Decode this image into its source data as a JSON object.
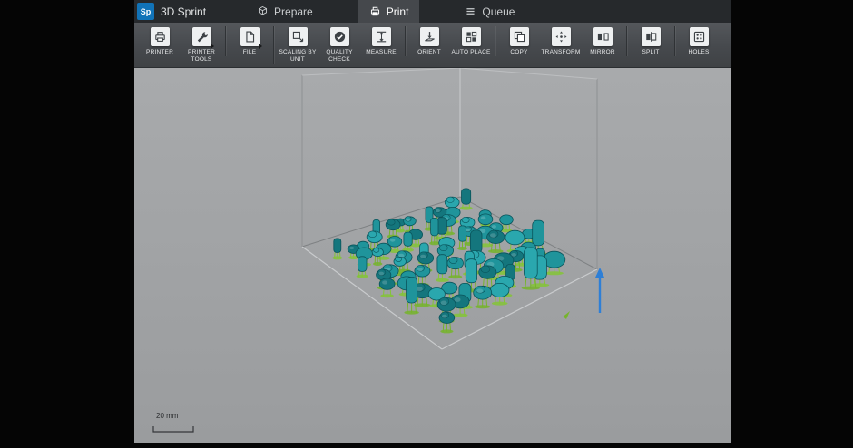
{
  "app": {
    "logo_text": "Sp",
    "title": "3D Sprint"
  },
  "tabs": [
    {
      "label": "Prepare",
      "icon": "cube-icon",
      "active": false
    },
    {
      "label": "Print",
      "icon": "printer-icon",
      "active": true
    },
    {
      "label": "Queue",
      "icon": "menu-icon",
      "active": false
    }
  ],
  "toolbar": {
    "groups": [
      {
        "buttons": [
          {
            "label": "PRINTER",
            "icon": "printer-icon",
            "flyout": false
          },
          {
            "label": "PRINTER TOOLS",
            "icon": "wrench-icon",
            "flyout": true
          }
        ]
      },
      {
        "buttons": [
          {
            "label": "FILE",
            "icon": "file-icon",
            "flyout": true
          }
        ]
      },
      {
        "buttons": [
          {
            "label": "SCALING BY UNIT",
            "icon": "scaling-icon",
            "flyout": false
          },
          {
            "label": "QUALITY CHECK",
            "icon": "quality-check-icon",
            "flyout": false
          },
          {
            "label": "MEASURE",
            "icon": "measure-icon",
            "flyout": false
          }
        ]
      },
      {
        "buttons": [
          {
            "label": "ORIENT",
            "icon": "orient-icon",
            "flyout": false
          },
          {
            "label": "AUTO PLACE",
            "icon": "auto-place-icon",
            "flyout": false
          }
        ]
      },
      {
        "buttons": [
          {
            "label": "COPY",
            "icon": "copy-icon",
            "flyout": false
          },
          {
            "label": "TRANSFORM",
            "icon": "transform-icon",
            "flyout": false
          },
          {
            "label": "MIRROR",
            "icon": "mirror-icon",
            "flyout": false
          }
        ]
      },
      {
        "buttons": [
          {
            "label": "SPLIT",
            "icon": "split-icon",
            "flyout": false
          }
        ]
      },
      {
        "buttons": [
          {
            "label": "HOLES",
            "icon": "holes-icon",
            "flyout": false
          }
        ]
      }
    ]
  },
  "viewport": {
    "scale_label": "20 mm",
    "colors": {
      "model_teal": "#1f949b",
      "model_teal_light": "#2aa7ae",
      "model_teal_dark": "#14767d",
      "model_outline": "#0a545b",
      "support_green": "#76b42c",
      "support_green_light": "#84c437",
      "axis_blue": "#2e7fd6",
      "platform_line": "#7e8183",
      "platform_line_light": "#c9cbcd"
    }
  }
}
